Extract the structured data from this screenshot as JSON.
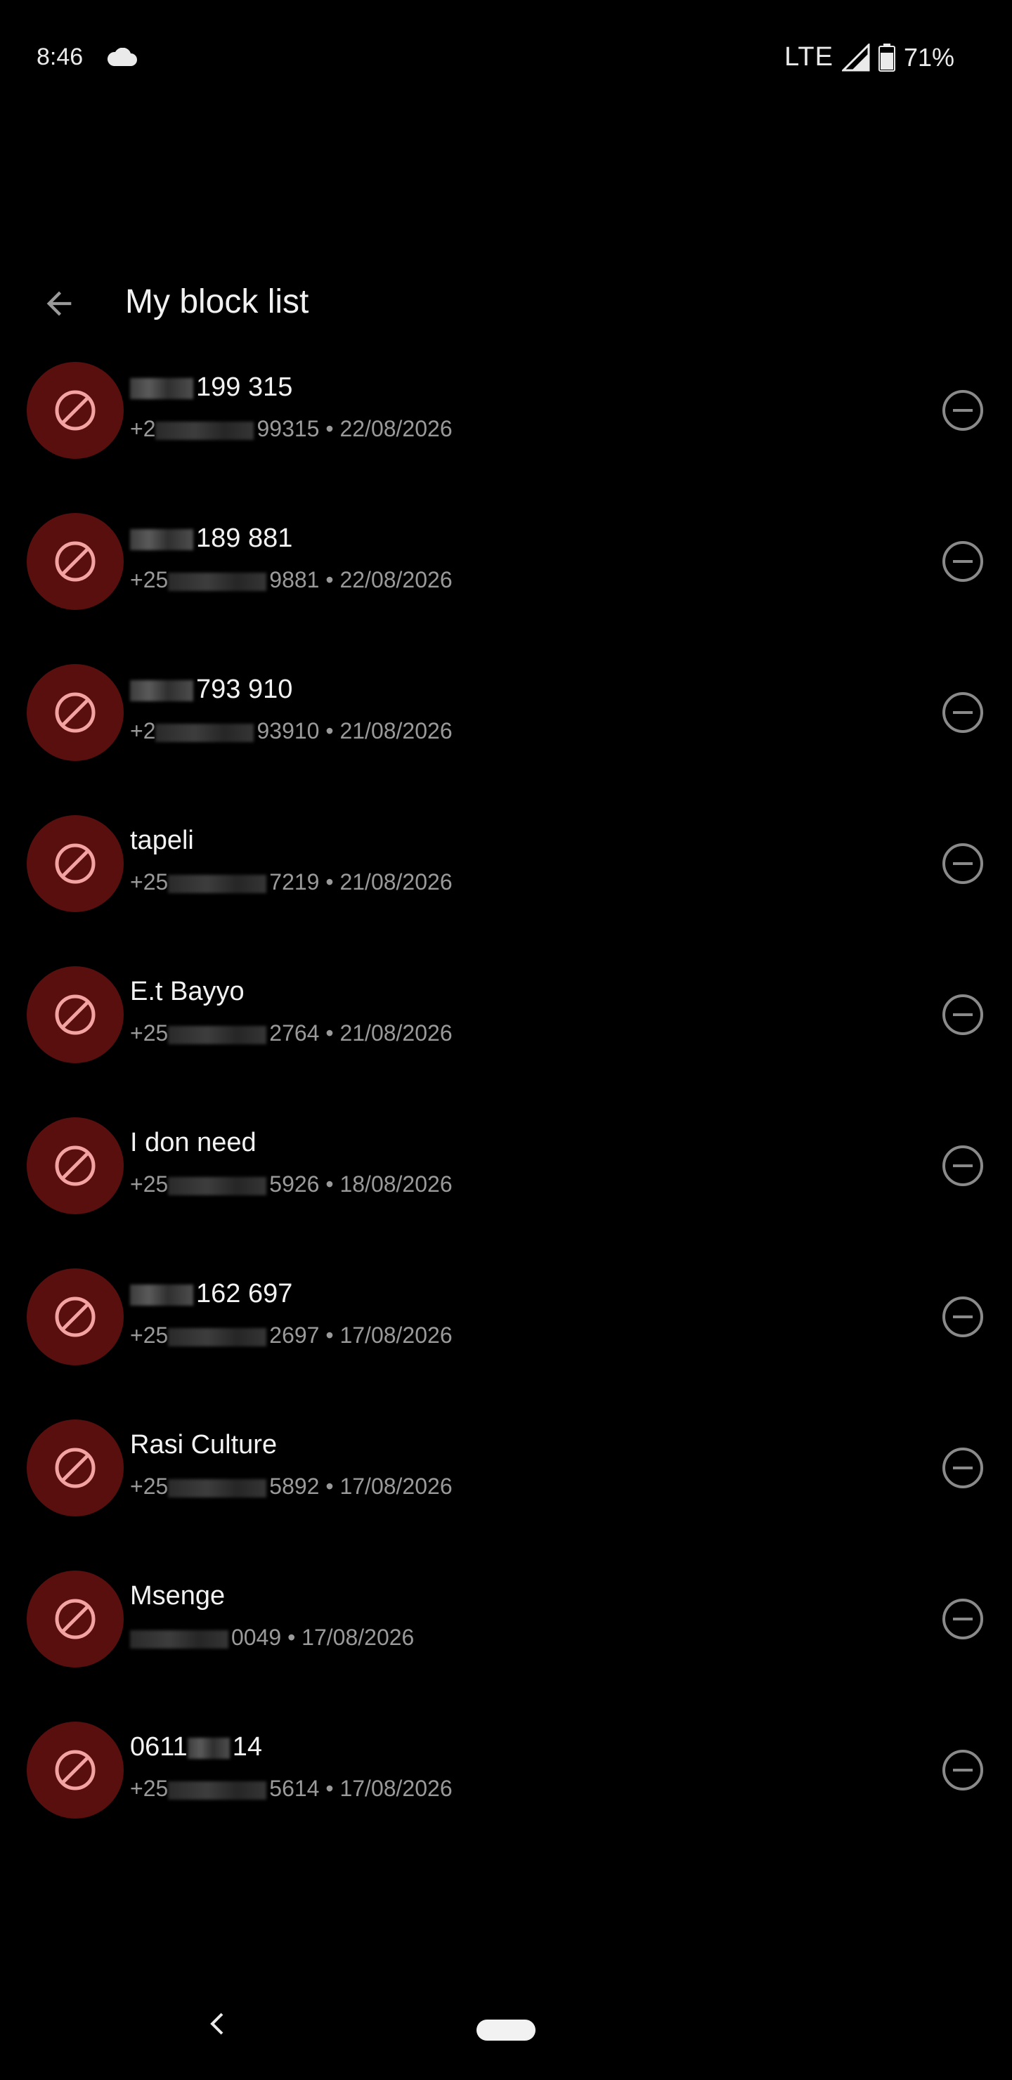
{
  "status_bar": {
    "time": "8:46",
    "network": "LTE",
    "battery": "71%"
  },
  "header": {
    "title": "My block list"
  },
  "colors": {
    "avatar_bg": "#5a0f0f",
    "avatar_icon": "#f4a3a3",
    "remove_icon": "#8a8a8a"
  },
  "items": [
    {
      "name": "199 315",
      "number": "+2",
      "number_tail": "99315",
      "date": "22/08/2026"
    },
    {
      "name": "189 881",
      "number": "+25",
      "number_tail": "9881",
      "date": "22/08/2026"
    },
    {
      "name": "793 910",
      "number": "+2",
      "number_tail": "93910",
      "date": "21/08/2026"
    },
    {
      "name": "tapeli",
      "number": "+25",
      "number_tail": "7219",
      "date": "21/08/2026"
    },
    {
      "name": "E.t Bayyo",
      "number": "+25",
      "number_tail": "2764",
      "date": "21/08/2026"
    },
    {
      "name": "I don need",
      "number": "+25",
      "number_tail": "5926",
      "date": "18/08/2026"
    },
    {
      "name": "162 697",
      "number": "+25",
      "number_tail": "2697",
      "date": "17/08/2026"
    },
    {
      "name": "Rasi Culture",
      "number": "+25",
      "number_tail": "5892",
      "date": "17/08/2026"
    },
    {
      "name": "Msenge",
      "number": "",
      "number_tail": "0049",
      "date": "17/08/2026"
    },
    {
      "name": "0611",
      "name_tail": "14",
      "number": "+25",
      "number_tail": "5614",
      "date": "17/08/2026"
    }
  ]
}
